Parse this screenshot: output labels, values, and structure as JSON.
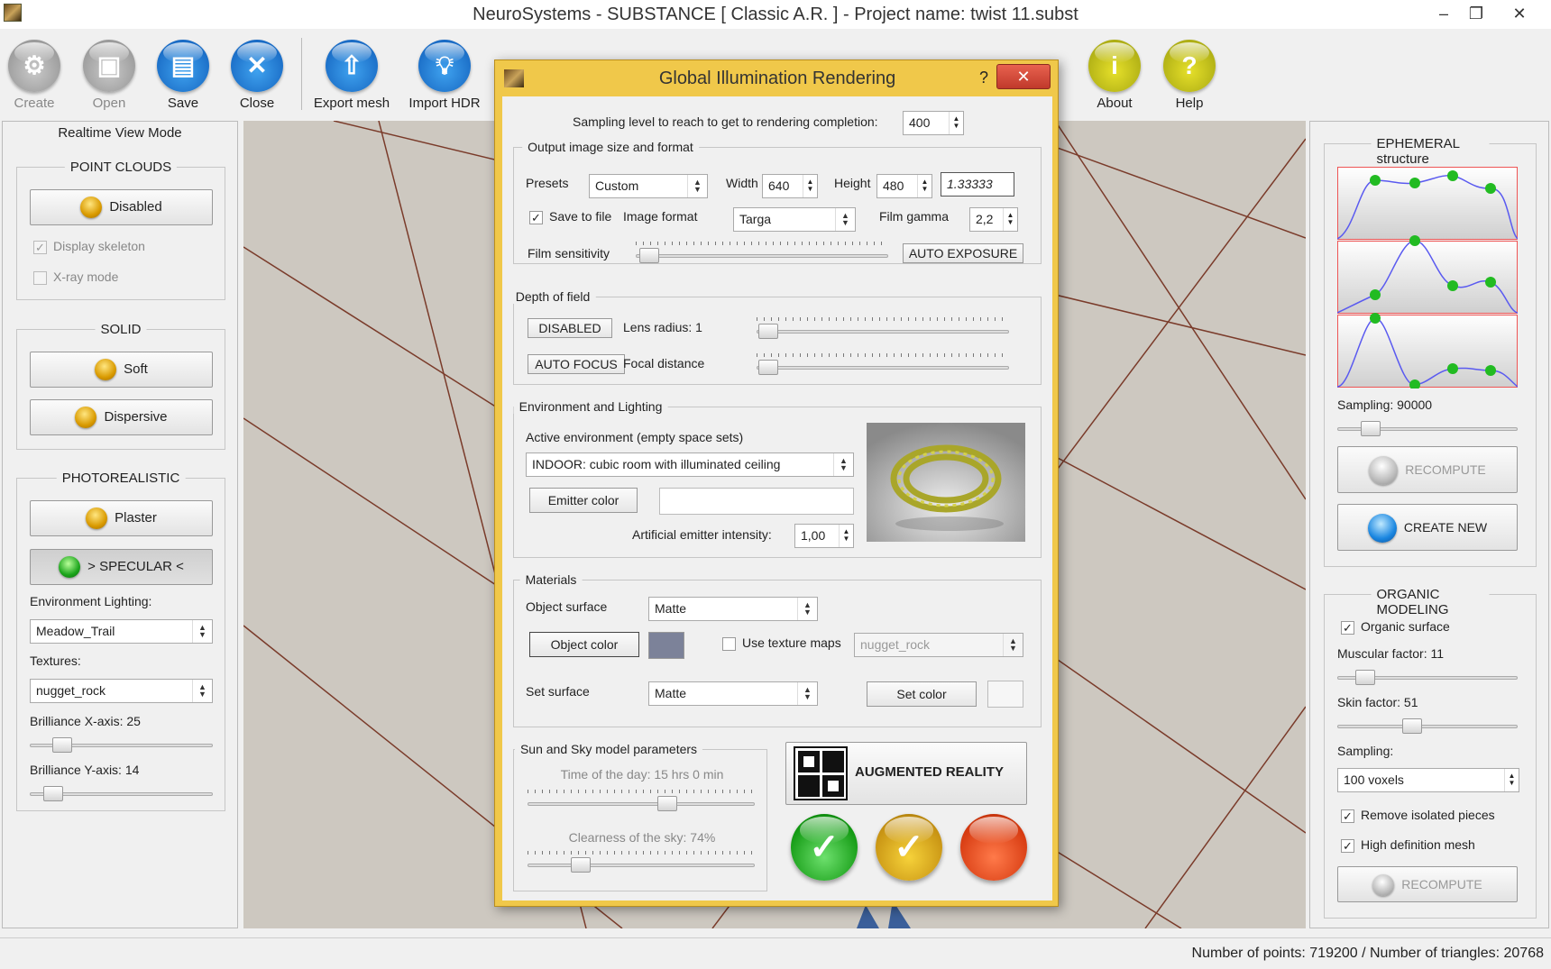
{
  "window": {
    "title": "NeuroSystems - SUBSTANCE  [ Classic A.R. ]  -  Project name: twist 11.subst",
    "minimize": "–",
    "restore": "❐",
    "close": "✕"
  },
  "toolbar": {
    "items": [
      {
        "label": "Create",
        "icon": "gear-icon"
      },
      {
        "label": "Open",
        "icon": "box-icon"
      },
      {
        "label": "Save",
        "icon": "floppy-icon"
      },
      {
        "label": "Close",
        "icon": "close-icon"
      },
      {
        "label": "Export mesh",
        "icon": "upload-icon"
      },
      {
        "label": "Import HDR",
        "icon": "lightbulb-icon"
      },
      {
        "label": "About",
        "icon": "info-icon"
      },
      {
        "label": "Help",
        "icon": "help-icon"
      }
    ]
  },
  "left": {
    "title": "Realtime View Mode",
    "point_clouds": {
      "title": "POINT CLOUDS",
      "button": "Disabled",
      "skeleton": "Display skeleton",
      "skeleton_checked": true,
      "xray": "X-ray mode",
      "xray_checked": false
    },
    "solid": {
      "title": "SOLID",
      "soft": "Soft",
      "dispersive": "Dispersive"
    },
    "photo": {
      "title": "PHOTOREALISTIC",
      "plaster": "Plaster",
      "specular": "> SPECULAR <",
      "env_label": "Environment Lighting:",
      "env_value": "Meadow_Trail",
      "tex_label": "Textures:",
      "tex_value": "nugget_rock",
      "bx_label": "Brilliance X-axis: 25",
      "bx_value": 25,
      "by_label": "Brilliance Y-axis: 14",
      "by_value": 14
    }
  },
  "dialog": {
    "title": "Global Illumination Rendering",
    "help": "?",
    "close": "✕",
    "sampling_label": "Sampling level to reach to get to rendering completion:",
    "sampling_value": "400",
    "output": {
      "title": "Output image size and format",
      "presets_label": "Presets",
      "presets_value": "Custom",
      "width_label": "Width",
      "width_value": "640",
      "height_label": "Height",
      "height_value": "480",
      "ratio": "1.33333",
      "save_label": "Save to file",
      "save_checked": true,
      "format_label": "Image format",
      "format_value": "Targa",
      "gamma_label": "Film gamma",
      "gamma_value": "2,2",
      "sensitivity_label": "Film sensitivity",
      "auto_exposure": "AUTO EXPOSURE"
    },
    "dof": {
      "title": "Depth of field",
      "disabled": "DISABLED",
      "lens_label": "Lens radius: 1",
      "autofocus": "AUTO FOCUS",
      "focal_label": "Focal distance"
    },
    "env": {
      "title": "Environment and Lighting",
      "active_label": "Active environment (empty space sets)",
      "active_value": "INDOOR: cubic room with illuminated ceiling",
      "emitter_btn": "Emitter color",
      "intensity_label": "Artificial emitter intensity:",
      "intensity_value": "1,00"
    },
    "materials": {
      "title": "Materials",
      "surface_label": "Object surface",
      "surface_value": "Matte",
      "color_btn": "Object color",
      "object_color": "#7c8299",
      "texture_label": "Use texture maps",
      "texture_value": "nugget_rock",
      "set_surface_label": "Set surface",
      "set_surface_value": "Matte",
      "set_color_btn": "Set color"
    },
    "sun": {
      "title": "Sun and Sky model parameters",
      "time_label": "Time of the day: 15 hrs 0 min",
      "time_value": 15,
      "clear_label": "Clearness of the sky: 74%",
      "clear_value": 74
    },
    "ar": "AUGMENTED REALITY"
  },
  "right": {
    "ephemeral": {
      "title": "EPHEMERAL structure",
      "sampling_label": "Sampling: 90000",
      "recompute": "RECOMPUTE",
      "create_new": "CREATE NEW"
    },
    "organic": {
      "title": "ORGANIC MODELING",
      "organic_label": "Organic surface",
      "organic_checked": true,
      "muscular_label": "Muscular factor: 11",
      "muscular_value": 11,
      "skin_label": "Skin factor: 51",
      "skin_value": 51,
      "sampling_label": "Sampling:",
      "sampling_value": "100 voxels",
      "remove_label": "Remove isolated pieces",
      "remove_checked": true,
      "hd_label": "High definition mesh",
      "hd_checked": true,
      "recompute": "RECOMPUTE"
    }
  },
  "status": {
    "text": "Number of points: 719200  /  Number of triangles: 20768"
  },
  "colors": {
    "dialog_frame": "#f0c84a",
    "close_red": "#c0392b",
    "accent_blue": "#1a86e0"
  }
}
